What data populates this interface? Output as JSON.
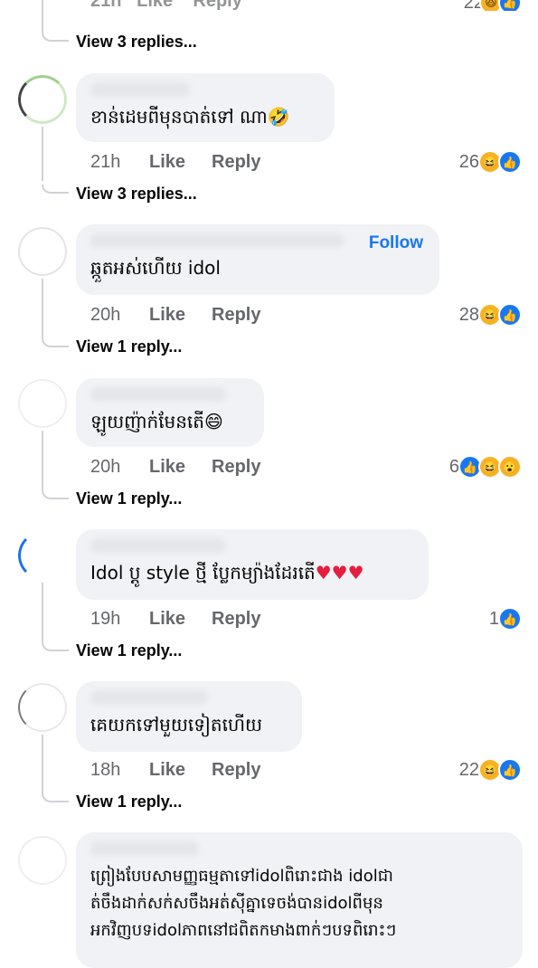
{
  "top": {
    "view_replies": "View 3 replies..."
  },
  "comments": [
    {
      "text": "ខាន់ដេមពីមុនបាត់ទៅ ណា🤣",
      "time": "21h",
      "like": "Like",
      "reply": "Reply",
      "count": "26",
      "reactions": [
        "haha-icon",
        "like-icon"
      ],
      "view_replies": "View 3 replies..."
    },
    {
      "text": "ឆ្កួតអស់ហើយ idol",
      "follow": "Follow",
      "time": "20h",
      "like": "Like",
      "reply": "Reply",
      "count": "28",
      "reactions": [
        "haha-icon",
        "like-icon"
      ],
      "view_replies": "View 1 reply..."
    },
    {
      "text": "ឡូយញ៉ាក់មែនតើ😄",
      "time": "20h",
      "like": "Like",
      "reply": "Reply",
      "count": "6",
      "reactions": [
        "like-icon",
        "haha-icon",
        "wow-icon"
      ],
      "view_replies": "View 1 reply..."
    },
    {
      "text": "Idol ប្ដូ style ថ្មី ប្លែកម្យ៉ាងដែរតើ",
      "hearts": "♥♥♥",
      "time": "19h",
      "like": "Like",
      "reply": "Reply",
      "count": "1",
      "reactions": [
        "like-icon"
      ],
      "view_replies": "View 1 reply..."
    },
    {
      "text": "គេយកទៅមួយទៀតហើយ",
      "time": "18h",
      "like": "Like",
      "reply": "Reply",
      "count": "22",
      "reactions": [
        "haha-icon",
        "like-icon"
      ],
      "view_replies": "View 1 reply..."
    },
    {
      "line1": "ព្រៀងបែបសាមញ្ញធម្មតាទៅidolពិរោះជាង idolជា",
      "line2": "ត់ចឹងដាក់សក់សចឹងអត់ស៊ីគ្នាទេចង់បានidolពីមុន",
      "line3": "អកវិញបទidolភាពនៅជពិតកមាងពាក់ៗបទពិរោះៗ"
    }
  ],
  "colors": {
    "accent": "#1877f2",
    "bubble": "#f0f2f5",
    "meta": "#65676b"
  }
}
